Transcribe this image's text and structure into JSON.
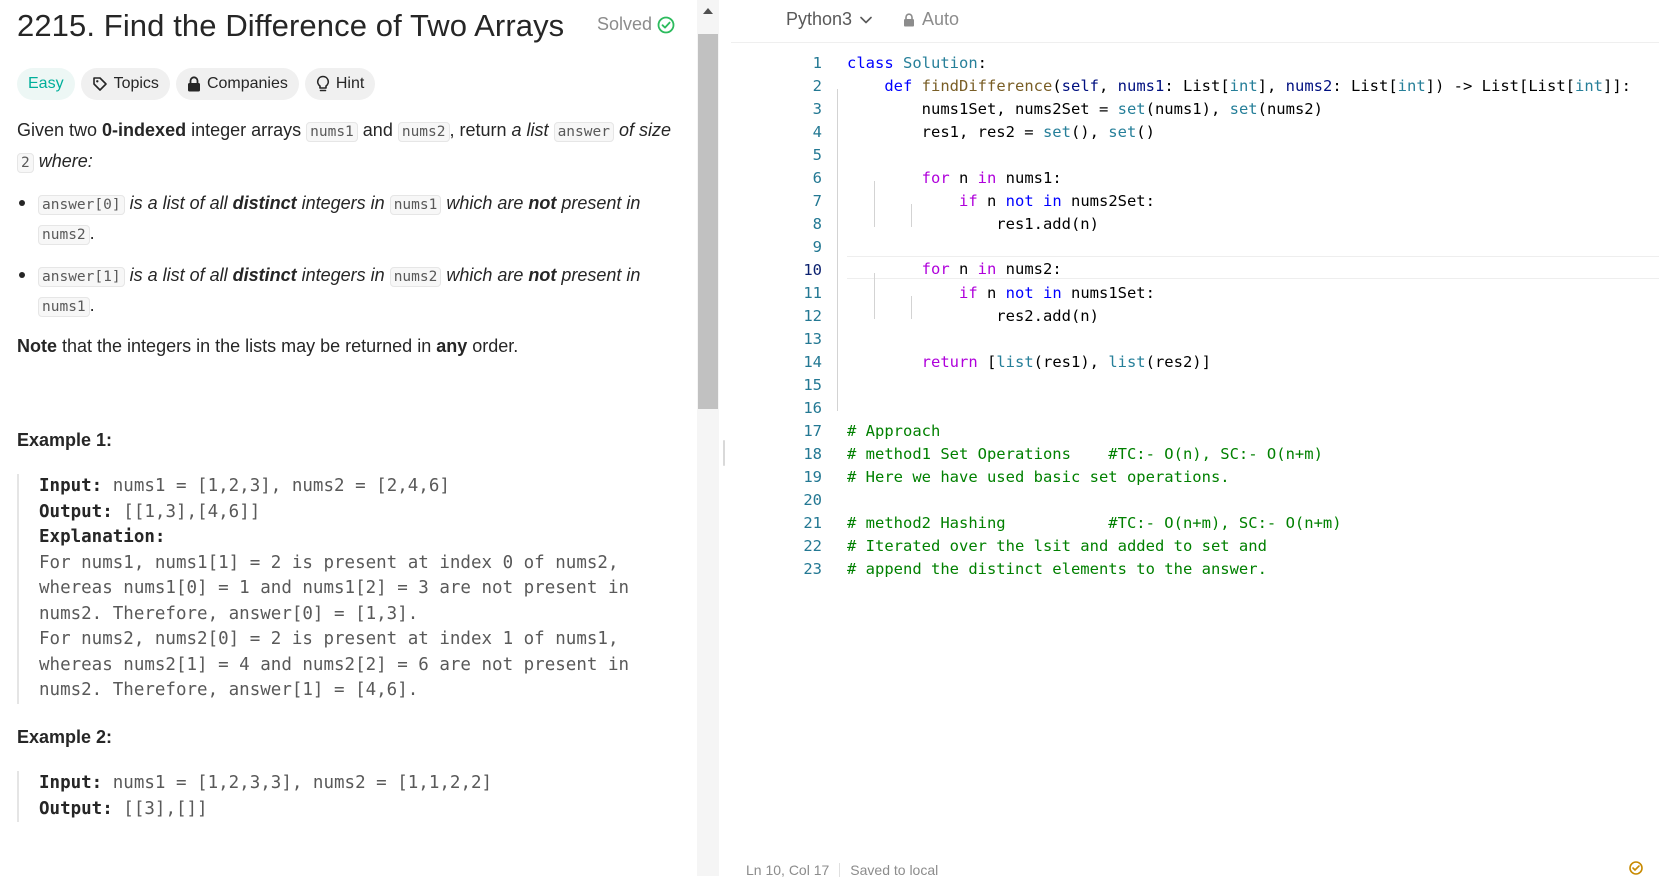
{
  "problem": {
    "title": "2215. Find the Difference of Two Arrays",
    "solved_label": "Solved",
    "tags": [
      {
        "label": "Easy"
      },
      {
        "label": "Topics",
        "icon": "tag-icon"
      },
      {
        "label": "Companies",
        "icon": "lock-icon"
      },
      {
        "label": "Hint",
        "icon": "lightbulb-icon"
      }
    ],
    "desc": {
      "t1": "Given two ",
      "b1": "0-indexed",
      "t2": " integer arrays ",
      "c1": "nums1",
      "t3": " and ",
      "c2": "nums2",
      "t4": ", return ",
      "i1": "a list",
      "t5": " ",
      "c3": "answer",
      "t6": " ",
      "i2": "of size",
      "t7": " ",
      "c4": "2",
      "t8": " ",
      "i3": "where:"
    },
    "bullets": [
      {
        "c1": "answer[0]",
        "i1": " is a list of all ",
        "b1": "distinct",
        "i2": " integers in ",
        "c2": "nums1",
        "i3": " which are ",
        "b2": "not",
        "i4": " present in ",
        "c3": "nums2",
        "end": "."
      },
      {
        "c1": "answer[1]",
        "i1": " is a list of all ",
        "b1": "distinct",
        "i2": " integers in ",
        "c2": "nums2",
        "i3": " which are ",
        "b2": "not",
        "i4": " present in ",
        "c3": "nums1",
        "end": "."
      }
    ],
    "note": {
      "b1": "Note",
      "t1": " that the integers in the lists may be returned in ",
      "b2": "any",
      "t2": " order."
    },
    "examples": [
      {
        "heading": "Example 1:",
        "input_label": "Input:",
        "input": " nums1 = [1,2,3], nums2 = [2,4,6]",
        "output_label": "Output:",
        "output": " [[1,3],[4,6]]",
        "explanation_label": "Explanation:",
        "explanation": [
          "For nums1, nums1[1] = 2 is present at index 0 of nums2,",
          "whereas nums1[0] = 1 and nums1[2] = 3 are not present in",
          "nums2. Therefore, answer[0] = [1,3].",
          "For nums2, nums2[0] = 2 is present at index 1 of nums1,",
          "whereas nums2[1] = 4 and nums2[2] = 6 are not present in",
          "nums2. Therefore, answer[1] = [4,6]."
        ]
      },
      {
        "heading": "Example 2:",
        "input_label": "Input:",
        "input": " nums1 = [1,2,3,3], nums2 = [1,1,2,2]",
        "output_label": "Output:",
        "output": " [[3],[]]"
      }
    ]
  },
  "editor": {
    "language": "Python3",
    "mode": "Auto",
    "current_line": 10,
    "status": {
      "position": "Ln 10, Col 17",
      "saved": "Saved to local"
    },
    "line_numbers": [
      "1",
      "2",
      "3",
      "4",
      "5",
      "6",
      "7",
      "8",
      "9",
      "10",
      "11",
      "12",
      "13",
      "14",
      "15",
      "16",
      "17",
      "18",
      "19",
      "20",
      "21",
      "22",
      "23"
    ],
    "code": {
      "l1": {
        "a": "class",
        "b": " ",
        "c": "Solution",
        "d": ":"
      },
      "l2": {
        "a": "    ",
        "b": "def",
        "c": " ",
        "d": "findDifference",
        "e": "(",
        "f": "self",
        "g": ", ",
        "h": "nums1",
        "i": ": List[",
        "j": "int",
        "k": "], ",
        "l": "nums2",
        "m": ": List[",
        "n": "int",
        "o": "]) -> List[List[",
        "p": "int",
        "q": "]]:"
      },
      "l3": {
        "a": "        nums1Set, nums2Set = ",
        "b": "set",
        "c": "(nums1), ",
        "d": "set",
        "e": "(nums2)"
      },
      "l4": {
        "a": "        res1, res2 = ",
        "b": "set",
        "c": "(), ",
        "d": "set",
        "e": "()"
      },
      "l6": {
        "a": "        ",
        "b": "for",
        "c": " n ",
        "d": "in",
        "e": " nums1:"
      },
      "l7": {
        "a": "            ",
        "b": "if",
        "c": " n ",
        "d": "not in",
        "e": " nums2Set:"
      },
      "l8": {
        "a": "                res1.add(n)"
      },
      "l10": {
        "a": "        ",
        "b": "for",
        "c": " n ",
        "d": "in",
        "e": " nums2:"
      },
      "l11": {
        "a": "            ",
        "b": "if",
        "c": " n ",
        "d": "not in",
        "e": " nums1Set:"
      },
      "l12": {
        "a": "                res2.add(n)"
      },
      "l14": {
        "a": "        ",
        "b": "return",
        "c": " [",
        "d": "list",
        "e": "(res1), ",
        "f": "list",
        "g": "(res2)]"
      },
      "l17": "# Approach",
      "l18": "# method1 Set Operations    #TC:- O(n), SC:- O(n+m)",
      "l19": "# Here we have used basic set operations.",
      "l21": "# method2 Hashing           #TC:- O(n+m), SC:- O(n+m)",
      "l22": "# Iterated over the lsit and added to set and",
      "l23": "# append the distinct elements to the answer."
    }
  },
  "colors": {
    "easy": "#00af9b",
    "solved": "#2cbb5d",
    "keyword": "#0000ff",
    "control": "#af00db",
    "type": "#267f99",
    "comment": "#008000",
    "function": "#795e26"
  }
}
